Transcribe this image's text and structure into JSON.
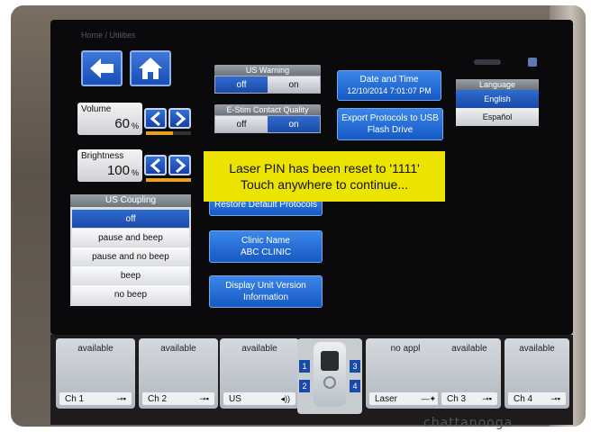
{
  "breadcrumb": "Home / Utilities",
  "nav": {
    "back_icon": "back-arrow-icon",
    "home_icon": "home-icon"
  },
  "volume": {
    "label": "Volume",
    "value": "60",
    "unit": "%",
    "level": 0.6
  },
  "brightness": {
    "label": "Brightness",
    "value": "100",
    "unit": "%",
    "level": 1.0
  },
  "us_warning": {
    "title": "US Warning",
    "off": "off",
    "on": "on",
    "selected": "off"
  },
  "estim_quality": {
    "title": "E-Stim Contact Quality",
    "off": "off",
    "on": "on",
    "selected": "on"
  },
  "date_time": {
    "label": "Date and Time",
    "value": "12/10/2014   7:01:07 PM"
  },
  "export": {
    "line1": "Export Protocols to USB",
    "line2": "Flash Drive"
  },
  "language": {
    "title": "Language",
    "options": [
      "English",
      "Español"
    ],
    "selected": "English"
  },
  "banner": {
    "line1": "Laser PIN has been reset to '1111'",
    "line2": "Touch anywhere to continue..."
  },
  "us_coupling": {
    "title": "US Coupling",
    "options": [
      "off",
      "pause and beep",
      "pause and no beep",
      "beep",
      "no beep"
    ],
    "selected": "off"
  },
  "restore": {
    "label": "Restore Default Protocols"
  },
  "clinic": {
    "line1": "Clinic Name",
    "line2": "ABC CLINIC"
  },
  "version": {
    "line1": "Display Unit Version",
    "line2": "Information"
  },
  "channels": [
    {
      "status": "available",
      "name": "Ch 1",
      "icon": "electrode-icon"
    },
    {
      "status": "available",
      "name": "Ch 2",
      "icon": "electrode-icon"
    },
    {
      "status": "available",
      "name": "US",
      "icon": "ultrasound-icon"
    },
    {
      "status": "no appl",
      "name": "Laser",
      "icon": "laser-icon"
    },
    {
      "status": "available",
      "name": "Ch 3",
      "icon": "electrode-icon"
    },
    {
      "status": "available",
      "name": "Ch 4",
      "icon": "electrode-icon"
    }
  ],
  "center_device": {
    "buttons": [
      "1",
      "2",
      "3",
      "4"
    ]
  },
  "brand": "chattanooga",
  "colors": {
    "accent": "#1a4aa8",
    "banner": "#ece300",
    "level": "#e8a020"
  }
}
